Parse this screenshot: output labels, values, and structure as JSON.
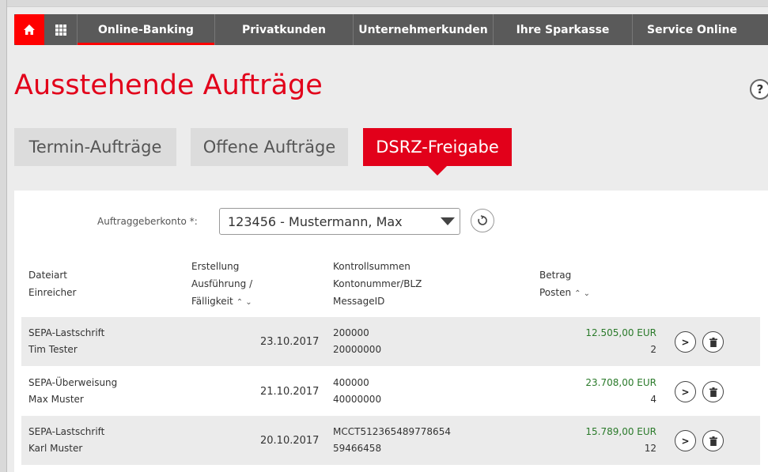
{
  "nav": {
    "items": [
      "Online-Banking",
      "Privatkunden",
      "Unternehmerkunden",
      "Ihre Sparkasse",
      "Service Online"
    ]
  },
  "page": {
    "title": "Ausstehende Aufträge",
    "help": "?"
  },
  "tabs": [
    "Termin-Aufträge",
    "Offene Aufträge",
    "DSRZ-Freigabe"
  ],
  "account": {
    "label": "Auftraggeberkonto *:",
    "value": "123456 - Mustermann, Max"
  },
  "table": {
    "headers": {
      "dateiart": "Dateiart",
      "einreicher": "Einreicher",
      "erstellung": "Erstellung",
      "ausfuehrung": "Ausführung /",
      "faelligkeit": "Fälligkeit",
      "kontrollsummen": "Kontrollsummen",
      "kontonummer": "Kontonummer/BLZ",
      "messageid": "MessageID",
      "betrag": "Betrag",
      "posten": "Posten",
      "sort": "⌃ ⌄"
    },
    "rows": [
      {
        "type": "SEPA-Lastschrift",
        "submitter": "Tim Tester",
        "date": "23.10.2017",
        "check1": "200000",
        "check2": "20000000",
        "amount": "12.505,00 EUR",
        "count": "2"
      },
      {
        "type": "SEPA-Überweisung",
        "submitter": "Max Muster",
        "date": "21.10.2017",
        "check1": "400000",
        "check2": "40000000",
        "amount": "23.708,00 EUR",
        "count": "4"
      },
      {
        "type": "SEPA-Lastschrift",
        "submitter": "Karl Muster",
        "date": "20.10.2017",
        "check1": "MCCT512365489778654",
        "check2": "59466458",
        "amount": "15.789,00 EUR",
        "count": "12"
      }
    ]
  },
  "colors": {
    "brand_red": "#e2001a",
    "nav_bg": "#5a5a5a",
    "amount_green": "#2a7a2a"
  },
  "icons": {
    "home": "home-icon",
    "grid": "grid-icon",
    "refresh": "refresh-icon",
    "details": "chevron-right-icon",
    "delete": "trash-icon"
  }
}
